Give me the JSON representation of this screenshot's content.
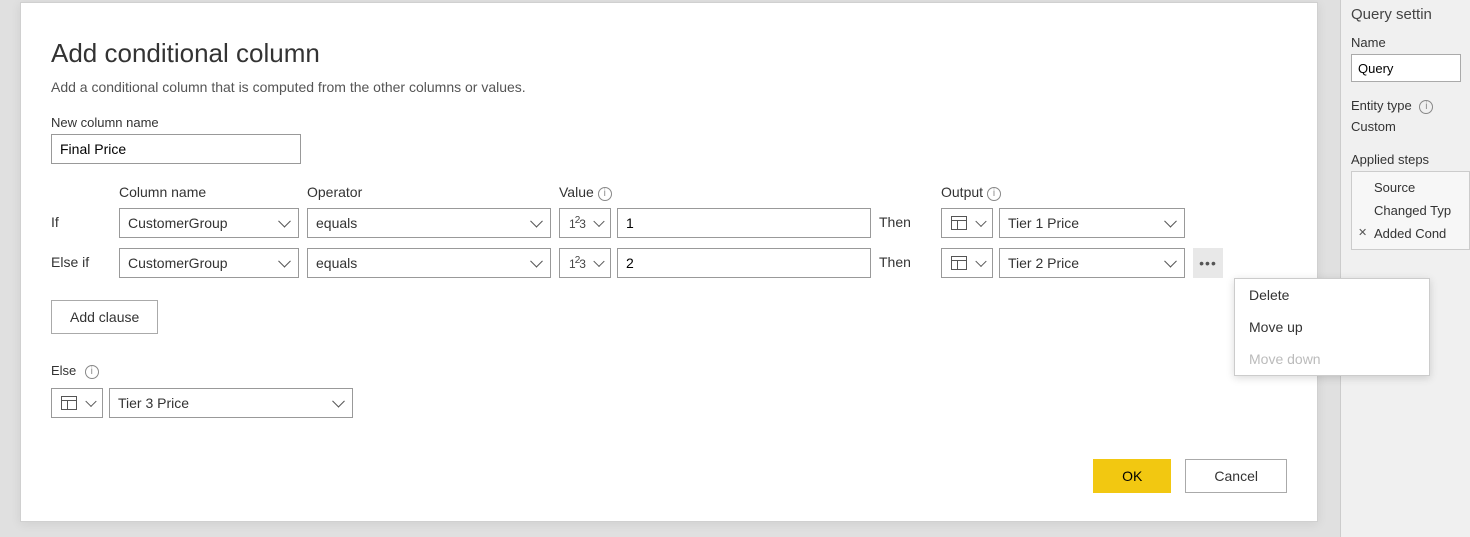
{
  "dialog": {
    "title": "Add conditional column",
    "subtitle": "Add a conditional column that is computed from the other columns or values.",
    "newcol_label": "New column name",
    "newcol_value": "Final Price",
    "headers": {
      "colname": "Column name",
      "operator": "Operator",
      "value": "Value",
      "output": "Output"
    },
    "rows": [
      {
        "lead": "If",
        "column": "CustomerGroup",
        "operator": "equals",
        "value": "1",
        "then": "Then",
        "output": "Tier 1 Price"
      },
      {
        "lead": "Else if",
        "column": "CustomerGroup",
        "operator": "equals",
        "value": "2",
        "then": "Then",
        "output": "Tier 2 Price"
      }
    ],
    "add_clause": "Add clause",
    "else_label": "Else",
    "else_value": "Tier 3 Price",
    "ok": "OK",
    "cancel": "Cancel"
  },
  "context_menu": {
    "delete": "Delete",
    "move_up": "Move up",
    "move_down": "Move down"
  },
  "side": {
    "title": "Query settin",
    "name_label": "Name",
    "name_value": "Query",
    "entity_label": "Entity type",
    "entity_value": "Custom",
    "steps_label": "Applied steps",
    "steps": [
      "Source",
      "Changed Typ",
      "Added Cond"
    ]
  }
}
